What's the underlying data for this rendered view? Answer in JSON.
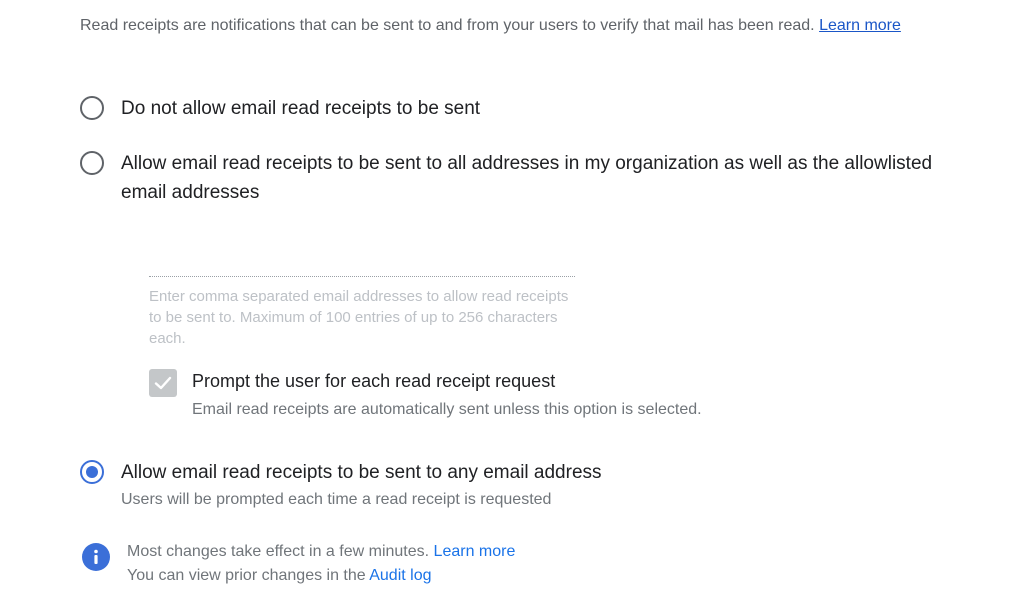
{
  "intro": {
    "text": "Read receipts are notifications that can be sent to and from your users to verify that mail has been read.",
    "learn_more": "Learn more"
  },
  "options": [
    {
      "label": "Do not allow email read receipts to be sent",
      "selected": false
    },
    {
      "label": "Allow email read receipts to be sent to all addresses in my organization as well as the allowlisted email addresses",
      "selected": false
    },
    {
      "label": "Allow email read receipts to be sent to any email address",
      "selected": true,
      "description": "Users will be prompted each time a read receipt is requested"
    }
  ],
  "allowlist": {
    "value": "",
    "helper": "Enter comma separated email addresses to allow read receipts to be sent to. Maximum of 100 entries of up to 256 characters each."
  },
  "prompt": {
    "label": "Prompt the user for each read receipt request",
    "description": "Email read receipts are automatically sent unless this option is selected.",
    "checked": true,
    "disabled": true
  },
  "info": {
    "line1": "Most changes take effect in a few minutes.",
    "line1_link": "Learn more",
    "line2": "You can view prior changes in the",
    "line2_link": "Audit log"
  },
  "colors": {
    "accent": "#3b6fd8",
    "link": "#1a73e8",
    "text": "#202124",
    "secondary": "#70757a"
  }
}
